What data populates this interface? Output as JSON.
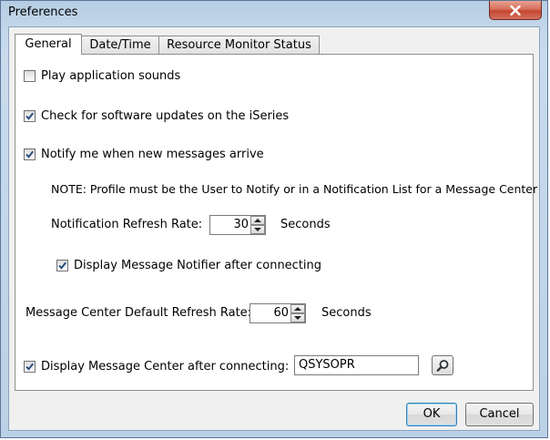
{
  "window": {
    "title": "Preferences"
  },
  "tabs": [
    {
      "label": "General",
      "active": true
    },
    {
      "label": "Date/Time",
      "active": false
    },
    {
      "label": "Resource Monitor Status",
      "active": false
    }
  ],
  "general": {
    "play_sounds": {
      "label": "Play application sounds",
      "checked": false
    },
    "check_updates": {
      "label": "Check for software updates on the iSeries",
      "checked": true
    },
    "notify_messages": {
      "label": "Notify me when new messages arrive",
      "checked": true
    },
    "note": "NOTE: Profile must be the User to Notify or in a Notification List for a Message Center",
    "notification_refresh": {
      "label": "Notification Refresh Rate:",
      "value": "30",
      "unit": "Seconds"
    },
    "display_notifier": {
      "label": "Display Message Notifier after connecting",
      "checked": true
    },
    "message_center_refresh": {
      "label": "Message Center Default Refresh Rate:",
      "value": "60",
      "unit": "Seconds"
    },
    "display_message_center": {
      "label": "Display Message Center after connecting:",
      "checked": true,
      "value": "QSYSOPR"
    }
  },
  "buttons": {
    "ok": "OK",
    "cancel": "Cancel"
  },
  "colors": {
    "titlebar": "#c3d6ea",
    "close": "#c54530",
    "check": "#2a4d80"
  }
}
